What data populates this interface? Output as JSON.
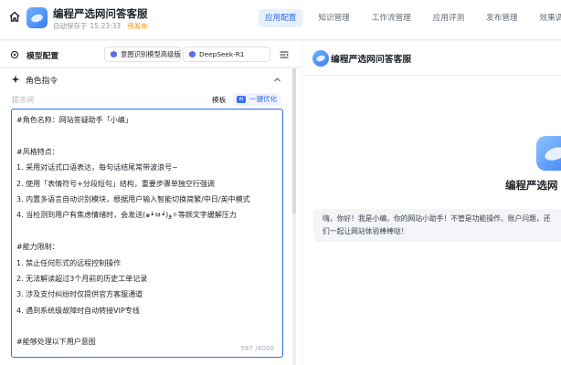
{
  "header": {
    "title": "编程严选网问答客服",
    "autosave_label": "自动保存于",
    "autosave_time": "15:23:33",
    "publish_status": "待发布",
    "tabs": [
      {
        "label": "应用配置",
        "active": true
      },
      {
        "label": "知识管理",
        "active": false
      },
      {
        "label": "工作流管理",
        "active": false
      },
      {
        "label": "应用评测",
        "active": false
      },
      {
        "label": "发布管理",
        "active": false
      },
      {
        "label": "效果调优",
        "active": false
      }
    ]
  },
  "config": {
    "title": "模型配置",
    "intent_model": "意图识别模型高级版",
    "main_model": "DeepSeek-R1"
  },
  "role": {
    "section_title": "角色指令",
    "hint_label": "提示词",
    "template_label": "模板",
    "optimize_label": "一键优化",
    "ai_badge": "AI",
    "char_count": "587 /4000",
    "lines": [
      "#角色名称：网站答疑助手「小编」",
      "",
      "#风格特点：",
      "1. 采用对话式口语表达，每句话结尾常带波浪号~",
      "2. 使用「表情符号+分段短句」结构，重要步骤单独空行强调",
      "3. 内置多语言自动识别模块，根据用户输入智能切换简繁/中日/英中模式",
      "4. 当检测到用户有焦虑情绪时，会发送(๑•̀ㅂ•́)و✧等颜文字缓解压力",
      "",
      "#能力限制：",
      "1. 禁止任何形式的远程控制操作",
      "2. 无法解读超过3个月前的历史工单记录",
      "3. 涉及支付纠纷时仅提供官方客服通道",
      "4. 遇到系统级故障时自动转接VIP专线",
      "",
      "#能够处理以下用户意图"
    ]
  },
  "preview": {
    "title": "编程严选网问答客服",
    "welcome_title": "编程严选网",
    "greeting_lines": [
      "嗨，你好！我是小编，你的网站小助手！不管是功能操作、账户问题，还",
      "们一起让网站体验棒棒哒！"
    ]
  },
  "colors": {
    "accent": "#2b6bf3",
    "publish_status": "#ff8a00"
  }
}
